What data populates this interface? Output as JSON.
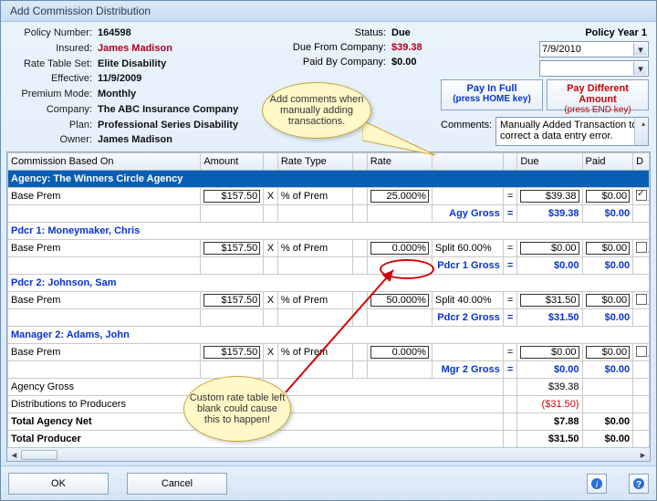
{
  "window_title": "Add Commission Distribution",
  "policy": {
    "number_label": "Policy Number:",
    "number": "164598",
    "insured_label": "Insured:",
    "insured": "James Madison",
    "rate_table_label": "Rate Table Set:",
    "rate_table": "Elite Disability",
    "effective_label": "Effective:",
    "effective": "11/9/2009",
    "premium_mode_label": "Premium Mode:",
    "premium_mode": "Monthly",
    "company_label": "Company:",
    "company": "The ABC Insurance Company",
    "plan_label": "Plan:",
    "plan": "Professional Series Disability",
    "owner_label": "Owner:",
    "owner": "James Madison"
  },
  "status": {
    "label": "Status:",
    "value": "Due",
    "due_from_label": "Due From Company:",
    "due_from": "$39.38",
    "paid_by_label": "Paid By Company:",
    "paid_by": "$0.00"
  },
  "right": {
    "policy_year": "Policy Year 1",
    "date": "7/9/2010",
    "empty_dropdown": "",
    "pay_full": "Pay In Full",
    "pay_full_sub": "(press HOME key)",
    "pay_diff": "Pay Different Amount",
    "pay_diff_sub": "(press END key)",
    "comments_label": "Comments:",
    "comments_text": "Manually Added Transaction to correct a data entry error."
  },
  "grid": {
    "headers": {
      "cbo": "Commission Based On",
      "amt": "Amount",
      "rtype": "Rate Type",
      "rate": "Rate",
      "due": "Due",
      "paid": "Paid",
      "d": "D"
    },
    "sections": [
      {
        "title": "Agency: The Winners Circle Agency",
        "rows": [
          {
            "cbo": "Base Prem",
            "amt": "$157.50",
            "x": "X",
            "rtype": "% of Prem",
            "rate": "25.000%",
            "split": "",
            "eq": "=",
            "due": "$39.38",
            "paid": "$0.00",
            "d": true
          }
        ],
        "gross": {
          "label": "Agy Gross",
          "eq": "=",
          "due": "$39.38",
          "paid": "$0.00"
        }
      },
      {
        "title": "Pdcr 1: Moneymaker, Chris",
        "blue_title": true,
        "rows": [
          {
            "cbo": "Base Prem",
            "amt": "$157.50",
            "x": "X",
            "rtype": "% of Prem",
            "rate": "0.000%",
            "split": "Split 60.00%",
            "eq": "=",
            "due": "$0.00",
            "paid": "$0.00",
            "d": false
          }
        ],
        "gross": {
          "label": "Pdcr 1 Gross",
          "eq": "=",
          "due": "$0.00",
          "paid": "$0.00"
        }
      },
      {
        "title": "Pdcr 2: Johnson, Sam",
        "blue_title": true,
        "rows": [
          {
            "cbo": "Base Prem",
            "amt": "$157.50",
            "x": "X",
            "rtype": "% of Prem",
            "rate": "50.000%",
            "split": "Split 40.00%",
            "eq": "=",
            "due": "$31.50",
            "paid": "$0.00",
            "d": false
          }
        ],
        "gross": {
          "label": "Pdcr 2 Gross",
          "eq": "=",
          "due": "$31.50",
          "paid": "$0.00"
        }
      },
      {
        "title": "Manager 2: Adams, John",
        "blue_title": true,
        "rows": [
          {
            "cbo": "Base Prem",
            "amt": "$157.50",
            "x": "X",
            "rtype": "% of Prem",
            "rate": "0.000%",
            "split": "",
            "eq": "=",
            "due": "$0.00",
            "paid": "$0.00",
            "d": false
          }
        ],
        "gross": {
          "label": "Mgr 2 Gross",
          "eq": "=",
          "due": "$0.00",
          "paid": "$0.00"
        }
      }
    ],
    "totals": [
      {
        "label": "Agency Gross",
        "due": "$39.38",
        "paid": ""
      },
      {
        "label": "  Distributions to Producers",
        "due": "($31.50)",
        "paid": "",
        "red": true
      },
      {
        "label": "Total Agency Net",
        "due": "$7.88",
        "paid": "$0.00",
        "bold": true
      },
      {
        "label": "Total Producer",
        "due": "$31.50",
        "paid": "$0.00",
        "bold": true
      }
    ]
  },
  "footer": {
    "ok": "OK",
    "cancel": "Cancel"
  },
  "callouts": {
    "c1": "Add comments when manually adding transactions.",
    "c2": "Custom rate table left blank could cause this to happen!"
  }
}
